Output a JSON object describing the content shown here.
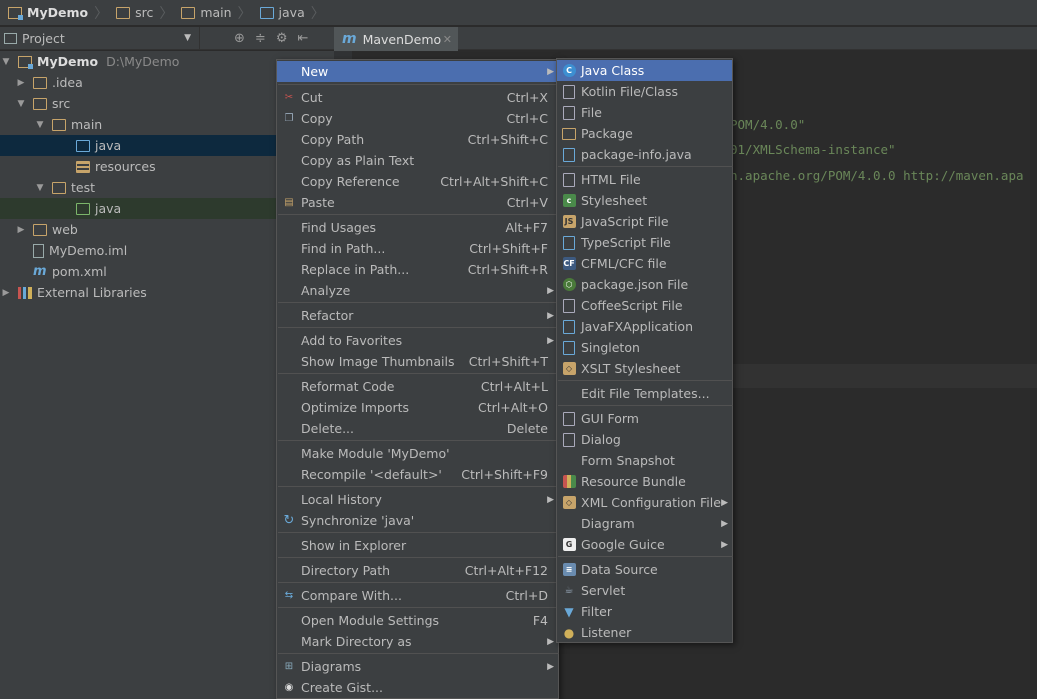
{
  "breadcrumb": [
    {
      "label": "MyDemo",
      "icon": "module-folder-icon"
    },
    {
      "label": "src",
      "icon": "folder-icon"
    },
    {
      "label": "main",
      "icon": "folder-icon"
    },
    {
      "label": "java",
      "icon": "source-folder-icon"
    }
  ],
  "project_panel": {
    "selector_label": "Project",
    "tree": [
      {
        "label": "MyDemo",
        "path": "D:\\MyDemo"
      },
      {
        "label": ".idea"
      },
      {
        "label": "src"
      },
      {
        "label": "main"
      },
      {
        "label": "java"
      },
      {
        "label": "resources"
      },
      {
        "label": "test"
      },
      {
        "label": "java"
      },
      {
        "label": "web"
      },
      {
        "label": "MyDemo.iml"
      },
      {
        "label": "pom.xml"
      },
      {
        "label": "External Libraries"
      }
    ]
  },
  "editor": {
    "tab_label": "MavenDemo",
    "code_lines": [
      "POM/4.0.0\"",
      "01/XMLSchema-instance\"",
      "n.apache.org/POM/4.0.0 http://maven.apa"
    ]
  },
  "context_menu": {
    "items": [
      {
        "label": "New",
        "shortcut": ""
      },
      {
        "label": "Cut",
        "shortcut": "Ctrl+X"
      },
      {
        "label": "Copy",
        "shortcut": "Ctrl+C"
      },
      {
        "label": "Copy Path",
        "shortcut": "Ctrl+Shift+C"
      },
      {
        "label": "Copy as Plain Text",
        "shortcut": ""
      },
      {
        "label": "Copy Reference",
        "shortcut": "Ctrl+Alt+Shift+C"
      },
      {
        "label": "Paste",
        "shortcut": "Ctrl+V"
      },
      {
        "label": "Find Usages",
        "shortcut": "Alt+F7"
      },
      {
        "label": "Find in Path...",
        "shortcut": "Ctrl+Shift+F"
      },
      {
        "label": "Replace in Path...",
        "shortcut": "Ctrl+Shift+R"
      },
      {
        "label": "Analyze",
        "shortcut": ""
      },
      {
        "label": "Refactor",
        "shortcut": ""
      },
      {
        "label": "Add to Favorites",
        "shortcut": ""
      },
      {
        "label": "Show Image Thumbnails",
        "shortcut": "Ctrl+Shift+T"
      },
      {
        "label": "Reformat Code",
        "shortcut": "Ctrl+Alt+L"
      },
      {
        "label": "Optimize Imports",
        "shortcut": "Ctrl+Alt+O"
      },
      {
        "label": "Delete...",
        "shortcut": "Delete"
      },
      {
        "label": "Make Module 'MyDemo'",
        "shortcut": ""
      },
      {
        "label": "Recompile '<default>'",
        "shortcut": "Ctrl+Shift+F9"
      },
      {
        "label": "Local History",
        "shortcut": ""
      },
      {
        "label": "Synchronize 'java'",
        "shortcut": ""
      },
      {
        "label": "Show in Explorer",
        "shortcut": ""
      },
      {
        "label": "Directory Path",
        "shortcut": "Ctrl+Alt+F12"
      },
      {
        "label": "Compare With...",
        "shortcut": "Ctrl+D"
      },
      {
        "label": "Open Module Settings",
        "shortcut": "F4"
      },
      {
        "label": "Mark Directory as",
        "shortcut": ""
      },
      {
        "label": "Diagrams",
        "shortcut": ""
      },
      {
        "label": "Create Gist...",
        "shortcut": ""
      }
    ]
  },
  "new_submenu": {
    "items": [
      {
        "label": "Java Class"
      },
      {
        "label": "Kotlin File/Class"
      },
      {
        "label": "File"
      },
      {
        "label": "Package"
      },
      {
        "label": "package-info.java"
      },
      {
        "label": "HTML File"
      },
      {
        "label": "Stylesheet"
      },
      {
        "label": "JavaScript File"
      },
      {
        "label": "TypeScript File"
      },
      {
        "label": "CFML/CFC file"
      },
      {
        "label": "package.json File"
      },
      {
        "label": "CoffeeScript File"
      },
      {
        "label": "JavaFXApplication"
      },
      {
        "label": "Singleton"
      },
      {
        "label": "XSLT Stylesheet"
      },
      {
        "label": "Edit File Templates..."
      },
      {
        "label": "GUI Form"
      },
      {
        "label": "Dialog"
      },
      {
        "label": "Form Snapshot"
      },
      {
        "label": "Resource Bundle"
      },
      {
        "label": "XML Configuration File"
      },
      {
        "label": "Diagram"
      },
      {
        "label": "Google Guice"
      },
      {
        "label": "Data Source"
      },
      {
        "label": "Servlet"
      },
      {
        "label": "Filter"
      },
      {
        "label": "Listener"
      }
    ]
  },
  "colors": {
    "highlight": "#4b6eaf",
    "panel": "#3c3f41",
    "editor": "#2b2b2b",
    "string": "#6a8759"
  }
}
